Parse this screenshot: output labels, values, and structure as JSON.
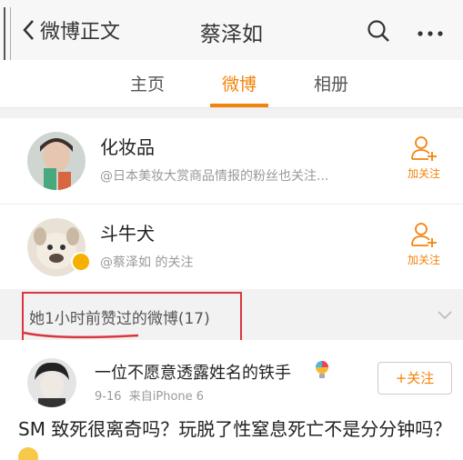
{
  "header": {
    "back_label": "微博正文",
    "title": "蔡泽如"
  },
  "tabs": [
    {
      "label": "主页",
      "active": false
    },
    {
      "label": "微博",
      "active": true
    },
    {
      "label": "相册",
      "active": false
    }
  ],
  "follow_list": [
    {
      "name": "化妆品",
      "subtitle": "@日本美妆大赏商品情报的粉丝也关注...",
      "follow_label": "加关注"
    },
    {
      "name": "斗牛犬",
      "subtitle": "@蔡泽如 的关注",
      "follow_label": "加关注"
    }
  ],
  "liked_section": {
    "label": "她1小时前赞过的微博(17)"
  },
  "post": {
    "author": "一位不愿意透露姓名的铁手",
    "date": "9-16",
    "source": "来自iPhone 6",
    "follow_button": "+关注",
    "content": "SM 致死很离奇吗？玩脱了性窒息死亡不是分分钟吗？"
  },
  "colors": {
    "accent": "#f3830a",
    "annotation": "#d9363e"
  }
}
